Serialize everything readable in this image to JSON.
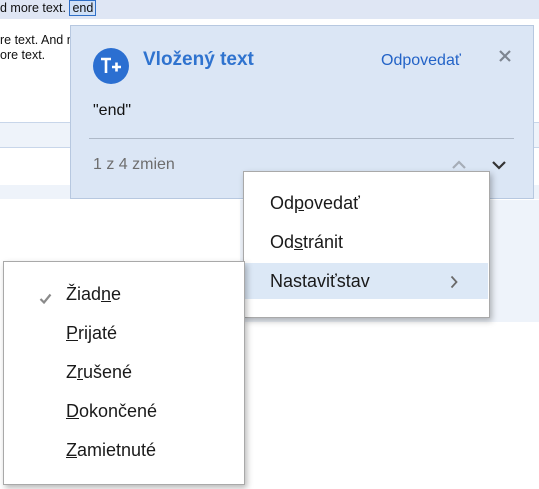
{
  "document": {
    "line1_before": "d more text.",
    "line1_highlight": "end",
    "line2": "re text. And m",
    "line3": "ore text."
  },
  "comment": {
    "avatar_glyph": "T+",
    "title": "Vložený text",
    "reply_label": "Odpovedať",
    "close_icon": "×",
    "quote": "\"end\"",
    "counter": "1 z 4 zmien",
    "accent_color": "#2f73cf"
  },
  "context_menu": {
    "items": [
      {
        "before": "Od",
        "key": "p",
        "after": "ovedať"
      },
      {
        "before": "Od",
        "key": "s",
        "after": "tránit"
      },
      {
        "before": "Nastavi",
        "key": "ť",
        "after": " stav"
      }
    ]
  },
  "status_submenu": {
    "items": [
      {
        "before": "Žiad",
        "key": "n",
        "after": "e",
        "checked": true
      },
      {
        "before": "",
        "key": "P",
        "after": "rijaté",
        "checked": false
      },
      {
        "before": "Z",
        "key": "r",
        "after": "ušené",
        "checked": false
      },
      {
        "before": "",
        "key": "D",
        "after": "okončené",
        "checked": false
      },
      {
        "before": "",
        "key": "Z",
        "after": "amietnuté",
        "checked": false
      }
    ]
  }
}
